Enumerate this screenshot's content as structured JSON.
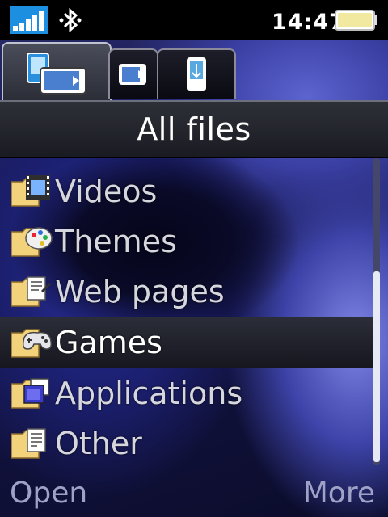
{
  "status": {
    "time": "14:47",
    "icons": [
      "signal-bars-icon",
      "bluetooth-icon",
      "battery-icon"
    ]
  },
  "tabs": [
    {
      "name": "all-files",
      "icon": "folders-memory-card-icon",
      "active": true
    },
    {
      "name": "memory-card",
      "icon": "memory-card-icon",
      "active": false
    },
    {
      "name": "phone",
      "icon": "phone-memory-icon",
      "active": false
    }
  ],
  "title": "All files",
  "list": [
    {
      "label": "Videos",
      "icon": "video-folder-icon"
    },
    {
      "label": "Themes",
      "icon": "themes-folder-icon"
    },
    {
      "label": "Web pages",
      "icon": "web-pages-folder-icon"
    },
    {
      "label": "Games",
      "icon": "games-folder-icon",
      "selected": true
    },
    {
      "label": "Applications",
      "icon": "applications-folder-icon"
    },
    {
      "label": "Other",
      "icon": "other-folder-icon"
    }
  ],
  "softkeys": {
    "left": "Open",
    "right": "More"
  },
  "colors": {
    "selection": "#20222c",
    "softkey_text": "#9fa2c6",
    "folder": "#f2d27a"
  }
}
